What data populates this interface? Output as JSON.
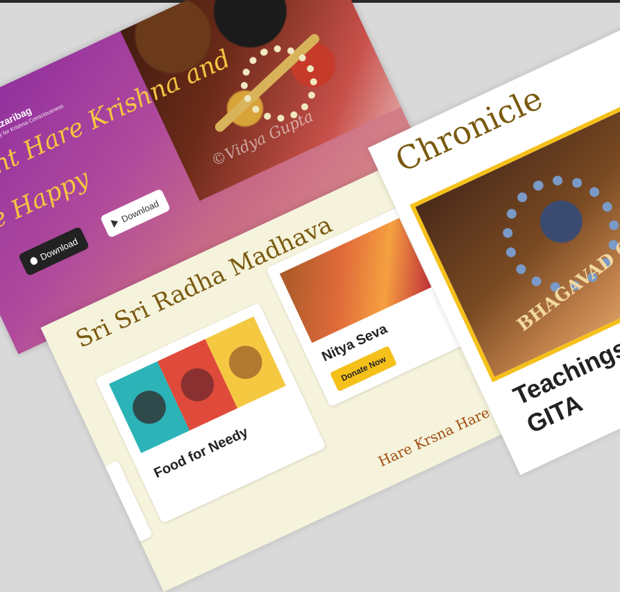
{
  "hero": {
    "brand_name": "ISKCON Hazaribag",
    "brand_sub": "International Society for Krishna Consciousness",
    "headline_line1": "Chant Hare Krishna and",
    "headline_line2": "Be Happy",
    "watermark": "©Vidya Gupta",
    "download_apple": "Download",
    "download_play": "Download"
  },
  "services": {
    "title": "Sri Sri Radha Madhava",
    "needy_title": "Food for Needy",
    "seva_title": "Nitya Seva",
    "donate_label": "Donate Now",
    "mantra": "Hare Krsna Hare Krsna Hare"
  },
  "chronicle": {
    "title": "Chronicle",
    "book_text": "BHAGAVAD GITA",
    "caption_line1": "Teachings from",
    "caption_line2": "GITA"
  }
}
